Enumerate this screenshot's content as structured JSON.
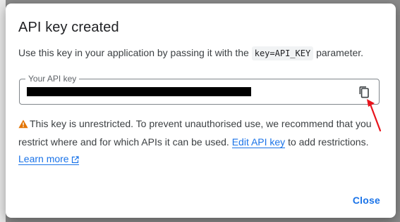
{
  "dialog": {
    "title": "API key created",
    "description_prefix": "Use this key in your application by passing it with the ",
    "description_code": "key=API_KEY",
    "description_suffix": " parameter.",
    "field_label": "Your API key",
    "copy_icon": "copy-icon",
    "warning_icon": "warning-icon",
    "warning_text": "This key is unrestricted. To prevent unauthorised use, we recommend that you restrict where and for which APIs it can be used. ",
    "edit_link": "Edit API key",
    "warning_suffix": " to add restrictions. ",
    "learn_more": "Learn more",
    "close_label": "Close"
  },
  "colors": {
    "accent": "#1a73e8",
    "warning": "#e37400",
    "annotation": "#e8141c"
  }
}
